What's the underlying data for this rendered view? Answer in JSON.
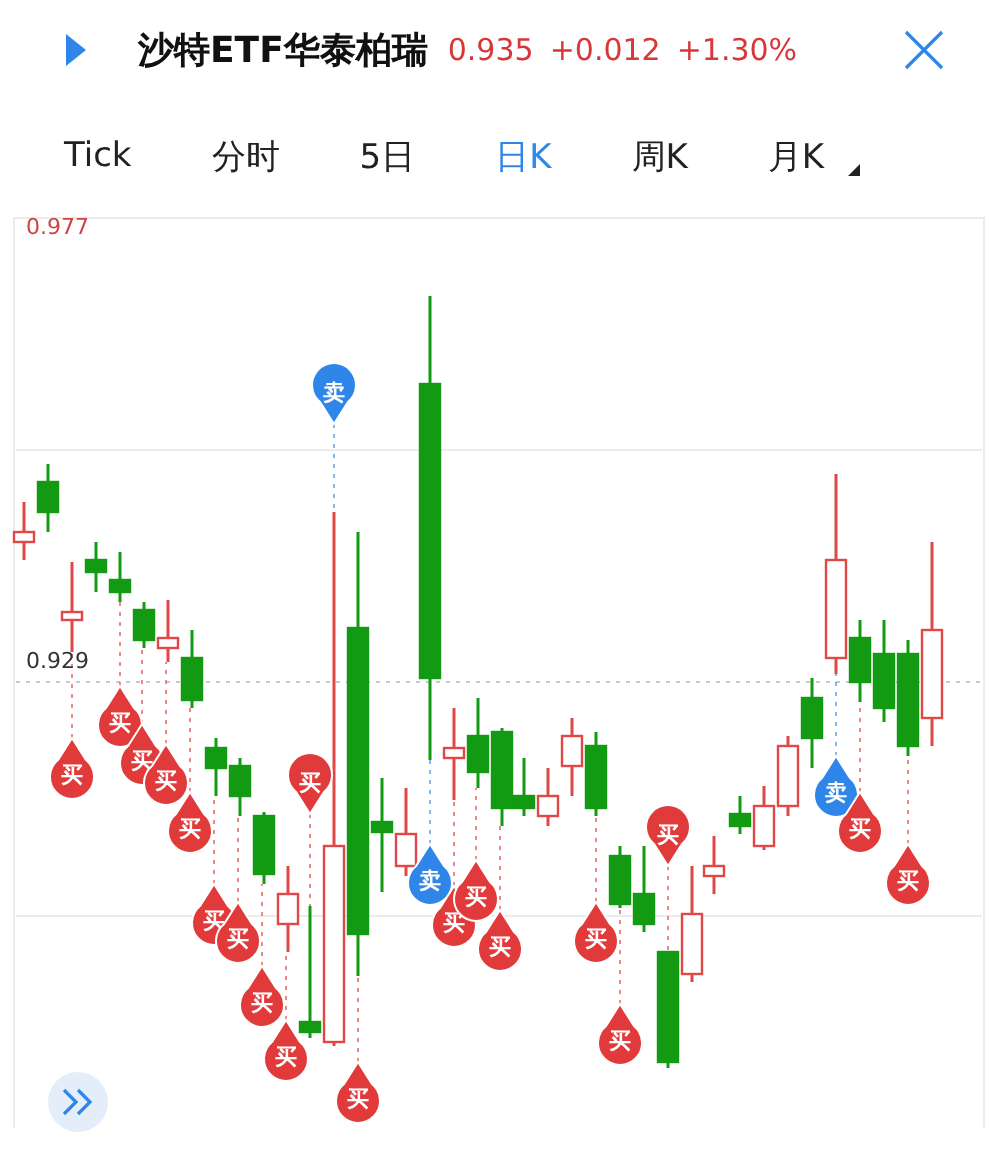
{
  "header": {
    "title": "沙特ETF华泰柏瑞",
    "price": "0.935",
    "change": "+0.012",
    "change_pct": "+1.30%"
  },
  "tabs": [
    {
      "label": "Tick",
      "selected": false
    },
    {
      "label": "分时",
      "selected": false
    },
    {
      "label": "5日",
      "selected": false
    },
    {
      "label": "日K",
      "selected": true
    },
    {
      "label": "周K",
      "selected": false
    },
    {
      "label": "月K",
      "selected": false
    }
  ],
  "chart": {
    "axis_labels": [
      {
        "text": "0.977",
        "kind": "high"
      },
      {
        "text": "0.929",
        "kind": "reference"
      }
    ],
    "signals": [
      {
        "kind": "buy",
        "label": "买"
      },
      {
        "kind": "buy",
        "label": "买"
      },
      {
        "kind": "buy",
        "label": "买"
      },
      {
        "kind": "buy",
        "label": "买"
      },
      {
        "kind": "buy",
        "label": "买"
      },
      {
        "kind": "buy",
        "label": "买"
      },
      {
        "kind": "buy",
        "label": "买"
      },
      {
        "kind": "buy",
        "label": "买"
      },
      {
        "kind": "buy",
        "label": "买"
      },
      {
        "kind": "buy",
        "label": "买"
      },
      {
        "kind": "sell",
        "label": "卖"
      },
      {
        "kind": "buy",
        "label": "买"
      },
      {
        "kind": "sell",
        "label": "卖"
      },
      {
        "kind": "buy",
        "label": "买"
      },
      {
        "kind": "buy",
        "label": "买"
      },
      {
        "kind": "buy",
        "label": "买"
      },
      {
        "kind": "buy",
        "label": "买"
      },
      {
        "kind": "buy",
        "label": "买"
      },
      {
        "kind": "buy",
        "label": "买"
      },
      {
        "kind": "sell",
        "label": "卖"
      },
      {
        "kind": "buy",
        "label": "买"
      },
      {
        "kind": "buy",
        "label": "买"
      }
    ]
  }
}
